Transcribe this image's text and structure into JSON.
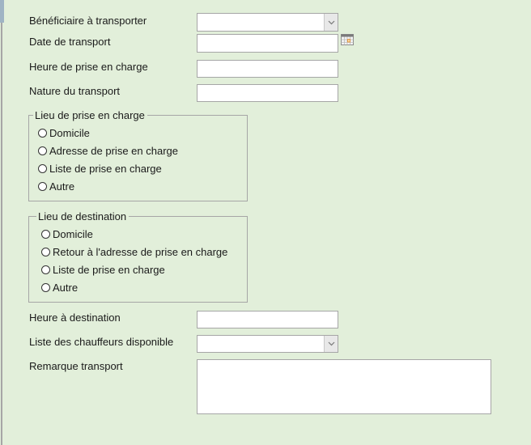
{
  "form": {
    "beneficiaire": {
      "label": "Bénéficiaire à transporter",
      "value": ""
    },
    "date_transport": {
      "label": "Date de transport",
      "value": ""
    },
    "heure_prise": {
      "label": "Heure de prise en charge",
      "value": ""
    },
    "nature": {
      "label": "Nature du transport",
      "value": ""
    },
    "lieu_prise": {
      "legend": "Lieu de prise en charge",
      "options": [
        "Domicile",
        "Adresse de prise en charge",
        "Liste de prise en charge",
        "Autre"
      ]
    },
    "lieu_destination": {
      "legend": "Lieu de destination",
      "options": [
        "Domicile",
        "Retour à l'adresse de prise en charge",
        "Liste de prise en charge",
        "Autre"
      ]
    },
    "heure_destination": {
      "label": "Heure à destination",
      "value": ""
    },
    "chauffeurs": {
      "label": "Liste des chauffeurs disponible",
      "value": ""
    },
    "remarque": {
      "label": "Remarque transport",
      "value": ""
    }
  },
  "icons": {
    "dropdown": "chevron-down-icon",
    "calendar": "calendar-icon"
  },
  "colors": {
    "background": "#e2efda",
    "border": "#a6a6a6"
  }
}
